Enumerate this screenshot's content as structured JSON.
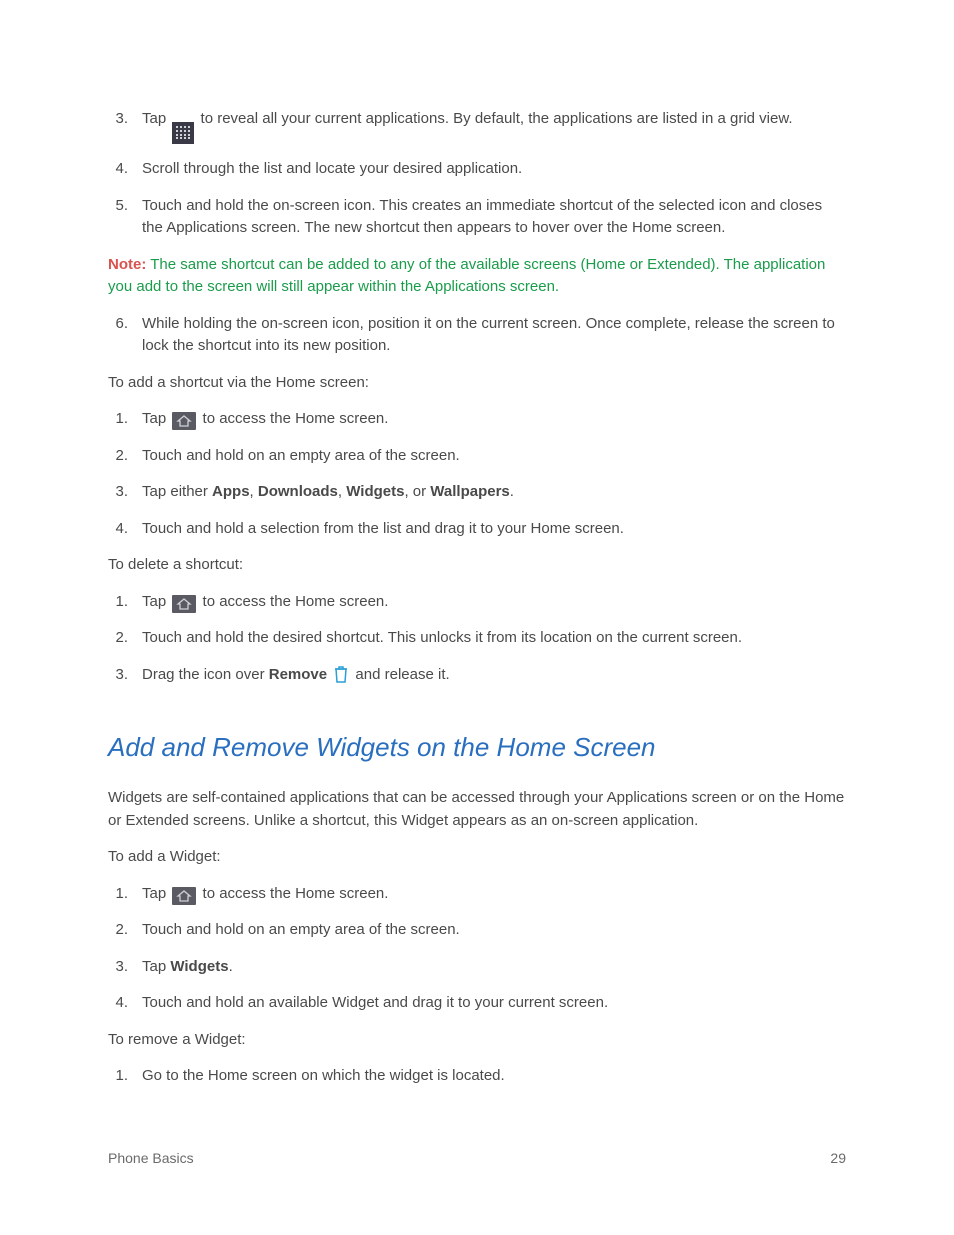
{
  "listA": {
    "i3_pre": "Tap ",
    "i3_post": " to reveal all your current applications. By default, the applications are listed in a grid view.",
    "i4": "Scroll through the list and locate your desired application.",
    "i5": "Touch and hold the on-screen icon. This creates an immediate shortcut of the selected icon and closes the Applications screen. The new shortcut then appears to hover over the Home screen.",
    "i6": "While holding the on-screen icon, position it on the current screen. Once complete, release the screen to lock the shortcut into its new position."
  },
  "note": {
    "label": "Note:",
    "text": "  The same shortcut can be added to any of the available screens (Home or Extended). The application you add to the screen will still appear within the Applications screen."
  },
  "paraB": "To add a shortcut via the Home screen:",
  "listB": {
    "i1_pre": "Tap ",
    "i1_post": " to access the Home screen.",
    "i2": "Touch and hold on an empty area of the screen.",
    "i3_pre": "Tap either ",
    "i3_b1": "Apps",
    "i3_s1": ", ",
    "i3_b2": "Downloads",
    "i3_s2": ", ",
    "i3_b3": "Widgets",
    "i3_s3": ", or ",
    "i3_b4": "Wallpapers",
    "i3_s4": ".",
    "i4": "Touch and hold a selection from the list and drag it to your Home screen."
  },
  "paraC": "To delete a shortcut:",
  "listC": {
    "i1_pre": "Tap ",
    "i1_post": " to access the Home screen.",
    "i2": "Touch and hold the desired shortcut. This unlocks it from its location on the current screen.",
    "i3_pre": "Drag the icon over ",
    "i3_b": "Remove",
    "i3_sp": " ",
    "i3_post": " and release it."
  },
  "heading": "Add and Remove Widgets on the Home Screen",
  "paraD": "Widgets are self-contained applications that can be accessed through your Applications screen or on the Home or Extended screens. Unlike a shortcut, this Widget appears as an on-screen application.",
  "paraE": "To add a Widget:",
  "listD": {
    "i1_pre": "Tap ",
    "i1_post": " to access the Home screen.",
    "i2": "Touch and hold on an empty area of the screen.",
    "i3_pre": "Tap ",
    "i3_b": "Widgets",
    "i3_post": ".",
    "i4": "Touch and hold an available Widget and drag it to your current screen."
  },
  "paraF": "To remove a Widget:",
  "listE": {
    "i1": "Go to the Home screen on which the widget is located."
  },
  "footer": {
    "left": "Phone Basics",
    "right": "29"
  },
  "nums": {
    "n1": "1.",
    "n2": "2.",
    "n3": "3.",
    "n4": "4.",
    "n5": "5.",
    "n6": "6."
  }
}
